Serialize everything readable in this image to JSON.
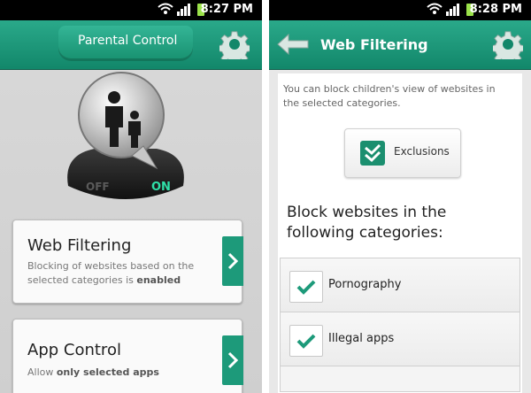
{
  "left": {
    "status_time": "8:27 PM",
    "title": "Parental Control",
    "toggle": {
      "off_label": "OFF",
      "on_label": "ON"
    },
    "cards": [
      {
        "title": "Web Filtering",
        "sub_text": "Blocking of websites based on the selected categories is ",
        "sub_bold": "enabled"
      },
      {
        "title": "App Control",
        "sub_text": "Allow ",
        "sub_bold": "only selected apps"
      }
    ]
  },
  "right": {
    "status_time": "8:28 PM",
    "title": "Web Filtering",
    "description": "You can block children's view of websites in the selected categories.",
    "exclusions_label": "Exclusions",
    "heading": "Block websites in the following categories:",
    "categories": [
      {
        "label": "Pornography",
        "checked": true
      },
      {
        "label": "Illegal apps",
        "checked": true
      }
    ]
  },
  "icons": {
    "settings": "gear-icon",
    "back": "back-arrow-icon",
    "checkbox": "checkmark-icon",
    "chevron": "chevron-right-icon",
    "family": "parent-child-icon"
  },
  "colors": {
    "accent": "#1d9a7a",
    "titlebar": "#12876a",
    "on_glow": "#2fe0a8"
  }
}
